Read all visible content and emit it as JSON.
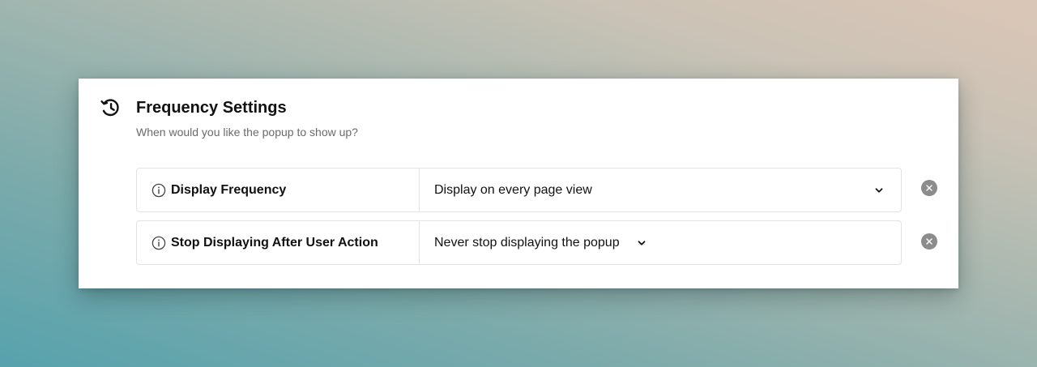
{
  "panel": {
    "title": "Frequency Settings",
    "subtitle": "When would you like the popup to show up?",
    "icon": "history-icon"
  },
  "rows": [
    {
      "label": "Display Frequency",
      "info_icon": "info-icon",
      "selected_value": "Display on every page view",
      "dropdown_icon": "chevron-down-icon",
      "remove_icon": "close-icon"
    },
    {
      "label": "Stop Displaying After User Action",
      "info_icon": "info-icon",
      "selected_value": "Never stop displaying the popup",
      "dropdown_icon": "chevron-down-icon",
      "remove_icon": "close-icon"
    }
  ],
  "colors": {
    "card_background": "#ffffff",
    "border": "#e3e3e3",
    "text_primary": "#111111",
    "text_secondary": "#6b6b6b",
    "remove_button": "#8c8c8c"
  }
}
